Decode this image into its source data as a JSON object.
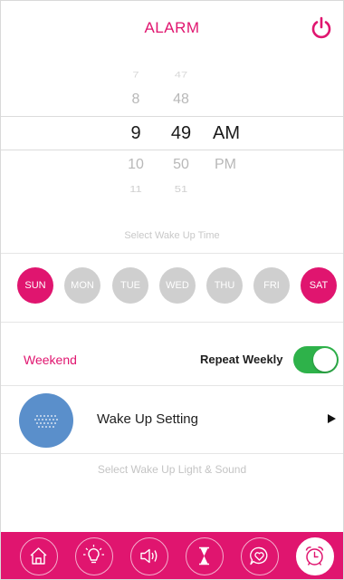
{
  "header": {
    "title": "ALARM",
    "power_icon": "power-icon"
  },
  "picker": {
    "hours": [
      "7",
      "8",
      "9",
      "10",
      "11"
    ],
    "minutes": [
      "47",
      "48",
      "49",
      "50",
      "51"
    ],
    "periods": [
      "AM",
      "PM"
    ],
    "selected": {
      "hour": "9",
      "minute": "49",
      "period": "AM"
    },
    "hint": "Select Wake Up Time"
  },
  "days": [
    {
      "label": "SUN",
      "active": true
    },
    {
      "label": "MON",
      "active": false
    },
    {
      "label": "TUE",
      "active": false
    },
    {
      "label": "WED",
      "active": false
    },
    {
      "label": "THU",
      "active": false
    },
    {
      "label": "FRI",
      "active": false
    },
    {
      "label": "SAT",
      "active": true
    }
  ],
  "repeat": {
    "mode_label": "Weekend",
    "toggle_label": "Repeat Weekly",
    "enabled": true
  },
  "wake": {
    "label": "Wake Up Setting",
    "hint": "Select Wake Up Light & Sound"
  },
  "tabs": [
    {
      "icon": "home-icon",
      "active": false
    },
    {
      "icon": "lightbulb-icon",
      "active": false
    },
    {
      "icon": "speaker-icon",
      "active": false
    },
    {
      "icon": "hourglass-icon",
      "active": false
    },
    {
      "icon": "heart-chat-icon",
      "active": false
    },
    {
      "icon": "alarm-clock-icon",
      "active": true
    }
  ],
  "colors": {
    "accent": "#e0156f",
    "toggle_on": "#2eb24a",
    "inactive_day": "#cfcfcf",
    "wake_circle": "#5a8fcb"
  }
}
